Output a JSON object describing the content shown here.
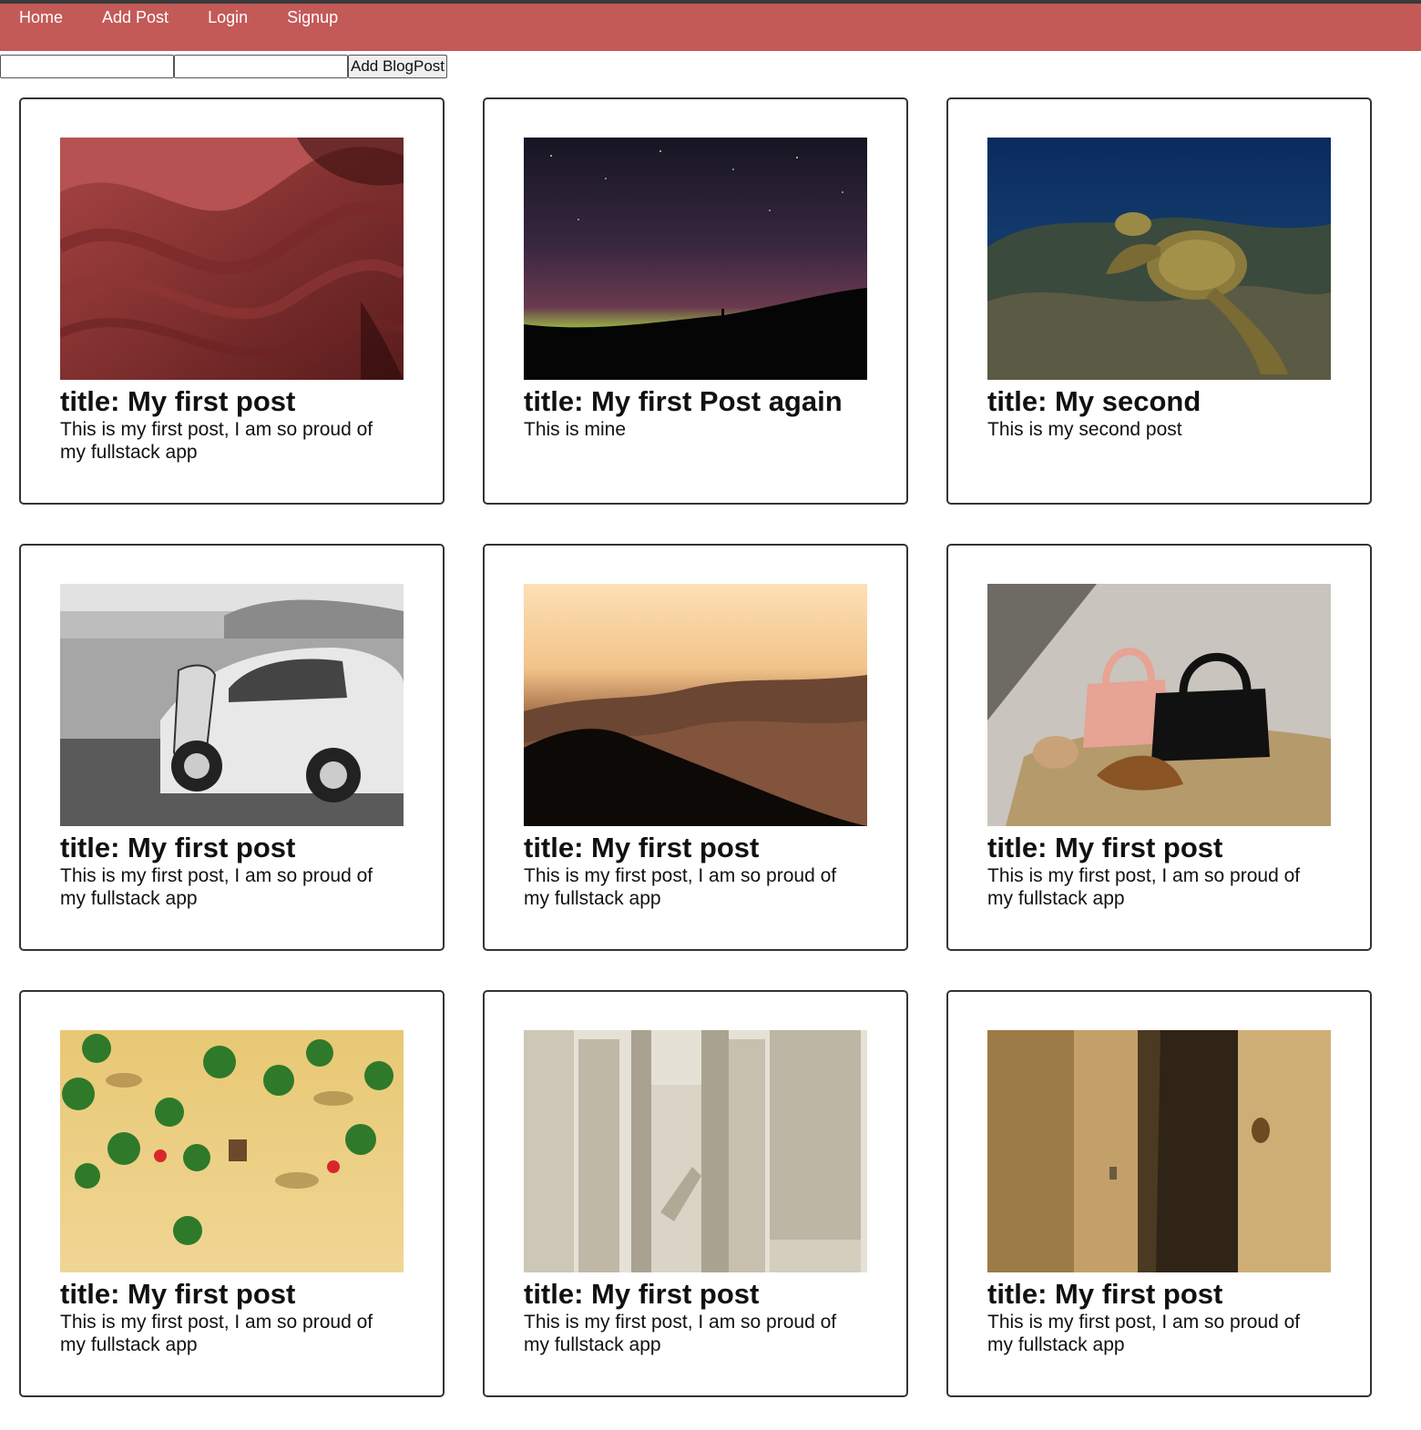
{
  "nav": {
    "items": [
      {
        "label": "Home"
      },
      {
        "label": "Add Post"
      },
      {
        "label": "Login"
      },
      {
        "label": "Signup"
      }
    ]
  },
  "form": {
    "title_value": "",
    "body_value": "",
    "submit_label": "Add BlogPost"
  },
  "colors": {
    "navbar": "#c35a58",
    "card_border": "#333333"
  },
  "posts": [
    {
      "title": "title: My first post",
      "body": "This is my first post, I am so proud of my fullstack app",
      "image": "red-waves-image"
    },
    {
      "title": "title: My first Post again",
      "body": "This is mine",
      "image": "aurora-night-sky-image"
    },
    {
      "title": "title: My second",
      "body": "This is my second post",
      "image": "sea-turtle-reef-image"
    },
    {
      "title": "title: My first post",
      "body": "This is my first post, I am so proud of my fullstack app",
      "image": "vintage-car-desert-image"
    },
    {
      "title": "title: My first post",
      "body": "This is my first post, I am so proud of my fullstack app",
      "image": "misty-mountain-sunset-image"
    },
    {
      "title": "title: My first post",
      "body": "This is my first post, I am so proud of my fullstack app",
      "image": "handbags-croissant-image"
    },
    {
      "title": "title: My first post",
      "body": "This is my first post, I am so proud of my fullstack app",
      "image": "palm-beach-aerial-image"
    },
    {
      "title": "title: My first post",
      "body": "This is my first post, I am so proud of my fullstack app",
      "image": "temple-columns-image"
    },
    {
      "title": "title: My first post",
      "body": "This is my first post, I am so proud of my fullstack app",
      "image": "stone-wall-shadow-image"
    }
  ]
}
